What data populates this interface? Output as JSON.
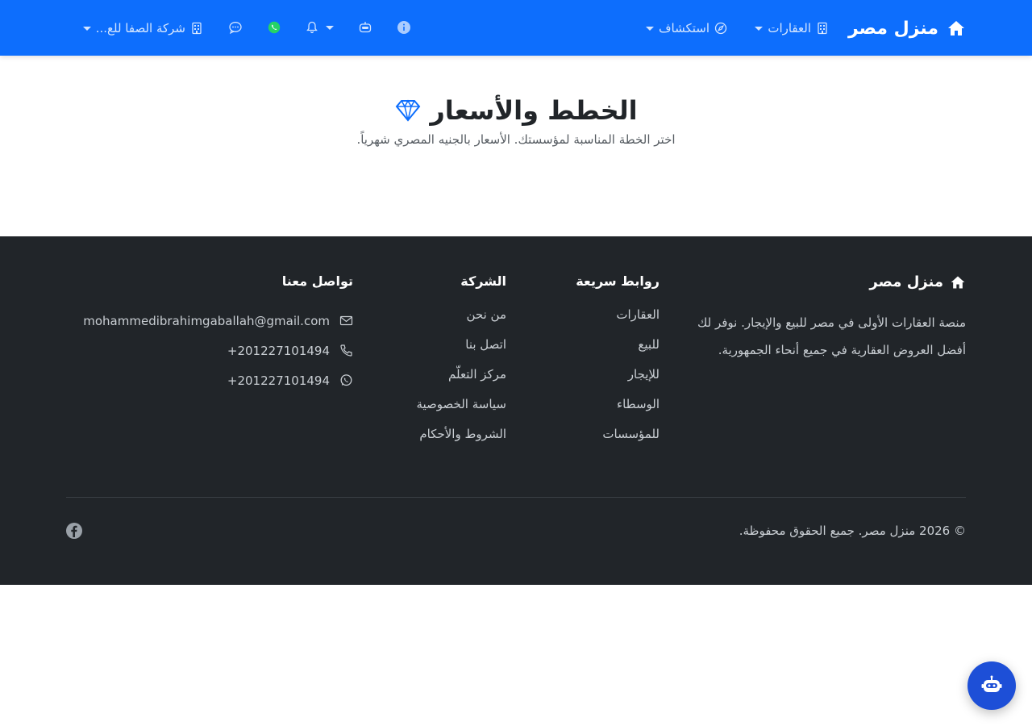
{
  "navbar": {
    "brand": "منزل مصر",
    "properties": "العقارات",
    "explore": "استكشاف",
    "company": "شركة الصفا للع..."
  },
  "hero": {
    "title": "الخطط والأسعار",
    "subtitle": "اختر الخطة المناسبة لمؤسستك. الأسعار بالجنيه المصري شهرياً."
  },
  "footer": {
    "brand": "منزل مصر",
    "description": "منصة العقارات الأولى في مصر للبيع والإيجار. نوفر لك أفضل العروض العقارية في جميع أنحاء الجمهورية.",
    "quick_links": {
      "heading": "روابط سريعة",
      "items": [
        "العقارات",
        "للبيع",
        "للإيجار",
        "الوسطاء",
        "للمؤسسات"
      ]
    },
    "company": {
      "heading": "الشركة",
      "items": [
        "من نحن",
        "اتصل بنا",
        "مركز التعلّم",
        "سياسة الخصوصية",
        "الشروط والأحكام"
      ]
    },
    "contact": {
      "heading": "تواصل معنا",
      "email": "mohammedibrahimgaballah@gmail.com",
      "phone": "+201227101494",
      "whatsapp": "+201227101494"
    },
    "copyright": "© 2026 منزل مصر. جميع الحقوق محفوظة."
  },
  "colors": {
    "primary": "#0d6efd",
    "footer_bg": "#212529",
    "whatsapp": "#25d366",
    "fab": "#1d4fd7"
  },
  "icons": {
    "brand": "home-icon",
    "properties": "building-icon",
    "explore": "compass-icon",
    "company": "building-icon",
    "chat": "chat-icon",
    "whatsapp": "whatsapp-icon",
    "bell": "bell-icon",
    "robot": "robot-icon",
    "info": "info-icon",
    "hero": "diamond-icon",
    "facebook": "facebook-icon"
  }
}
